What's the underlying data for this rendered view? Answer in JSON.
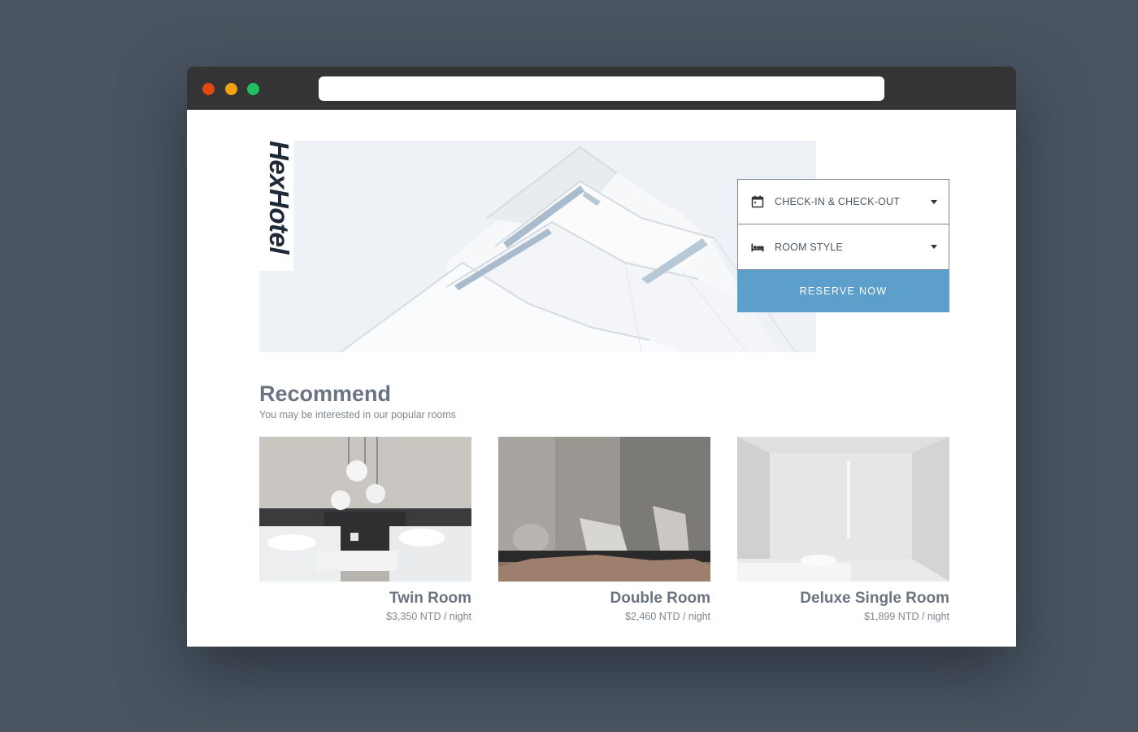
{
  "browser": {
    "url": ""
  },
  "brand": {
    "logo_text": "HexHotel"
  },
  "booking": {
    "date_field": {
      "label": "CHECK-IN & CHECK-OUT",
      "icon": "calendar-icon"
    },
    "room_field": {
      "label": "ROOM STYLE",
      "icon": "bed-icon"
    },
    "reserve_label": "RESERVE NOW",
    "accent_color": "#5c9fcb"
  },
  "recommend": {
    "title": "Recommend",
    "subtitle": "You may be interested in our popular rooms",
    "rooms": [
      {
        "name": "Twin Room",
        "price": "$3,350 NTD / night"
      },
      {
        "name": "Double Room",
        "price": "$2,460 NTD / night"
      },
      {
        "name": "Deluxe Single Room",
        "price": "$1,899 NTD / night"
      }
    ]
  }
}
